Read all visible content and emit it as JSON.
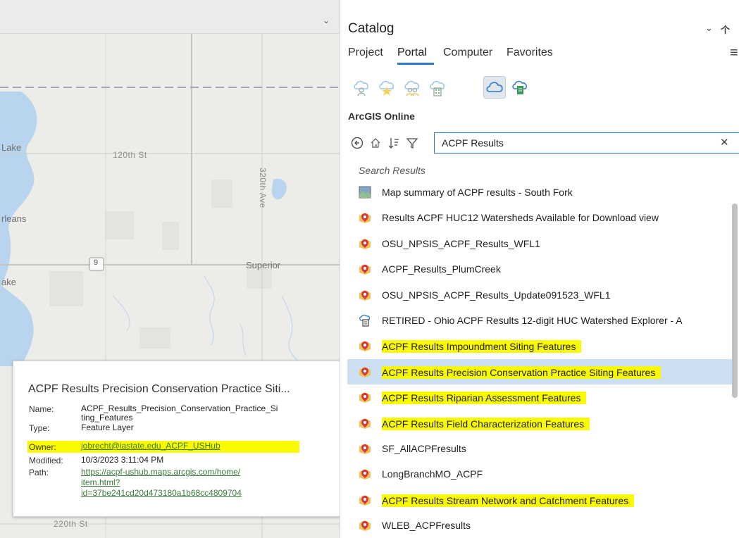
{
  "map": {
    "labels": {
      "lake1": "Lake",
      "street120": "120th St",
      "ave320": "320th Ave",
      "orleans": "rleans",
      "route9": "9",
      "superior": "Superior",
      "lake2": "ake",
      "street220": "220th St"
    }
  },
  "popup": {
    "title": "ACPF Results Precision Conservation Practice Siti...",
    "name_key": "Name:",
    "name_line1": "ACPF_Results_Precision_Conservation_Practice_Si",
    "name_line2": "ting_Features",
    "type_key": "Type:",
    "type_val": "Feature Layer",
    "owner_key": "Owner:",
    "owner_val": "jobrecht@iastate.edu_ACPF_USHub",
    "modified_key": "Modified:",
    "modified_val": "10/3/2023 3:11:04 PM",
    "path_key": "Path:",
    "path_line1": "https://acpf-ushub.maps.arcgis.com/home/",
    "path_line2": "item.html?",
    "path_line3": "id=37be241cd20d473180a1b68cc4809704"
  },
  "catalog": {
    "title": "Catalog",
    "tabs": [
      "Project",
      "Portal",
      "Computer",
      "Favorites"
    ],
    "active_tab": "Portal",
    "portal_label": "ArcGIS Online",
    "search_value": "ACPF Results",
    "results_label": "Search Results",
    "accent": "#2b78c5",
    "highlight": "#f9f900",
    "results": [
      {
        "label": "Map summary of ACPF results - South Fork",
        "icon": "map-icon",
        "hl": false
      },
      {
        "label": "Results ACPF HUC12 Watersheds Available for Download view",
        "icon": "feature-layer-icon",
        "hl": false
      },
      {
        "label": "OSU_NPSIS_ACPF_Results_WFL1",
        "icon": "feature-layer-icon",
        "hl": false
      },
      {
        "label": "ACPF_Results_PlumCreek",
        "icon": "feature-layer-icon",
        "hl": false
      },
      {
        "label": "OSU_NPSIS_ACPF_Results_Update091523_WFL1",
        "icon": "feature-layer-icon",
        "hl": false
      },
      {
        "label": "RETIRED - Ohio ACPF Results 12-digit HUC Watershed Explorer - A",
        "icon": "web-app-icon",
        "hl": false
      },
      {
        "label": "ACPF Results Impoundment Siting Features",
        "icon": "feature-layer-icon",
        "hl": true
      },
      {
        "label": "ACPF Results Precision Conservation Practice Siting Features",
        "icon": "feature-layer-icon",
        "hl": true,
        "selected": true
      },
      {
        "label": "ACPF Results Riparian Assessment Features",
        "icon": "feature-layer-icon",
        "hl": true
      },
      {
        "label": "ACPF Results Field Characterization Features",
        "icon": "feature-layer-icon",
        "hl": true
      },
      {
        "label": "SF_AllACPFresults",
        "icon": "feature-layer-icon",
        "hl": false
      },
      {
        "label": "LongBranchMO_ACPF",
        "icon": "feature-layer-icon",
        "hl": false
      },
      {
        "label": "ACPF Results Stream Network and Catchment Features",
        "icon": "feature-layer-icon",
        "hl": true
      },
      {
        "label": "WLEB_ACPFresults",
        "icon": "feature-layer-icon",
        "hl": false
      }
    ]
  }
}
